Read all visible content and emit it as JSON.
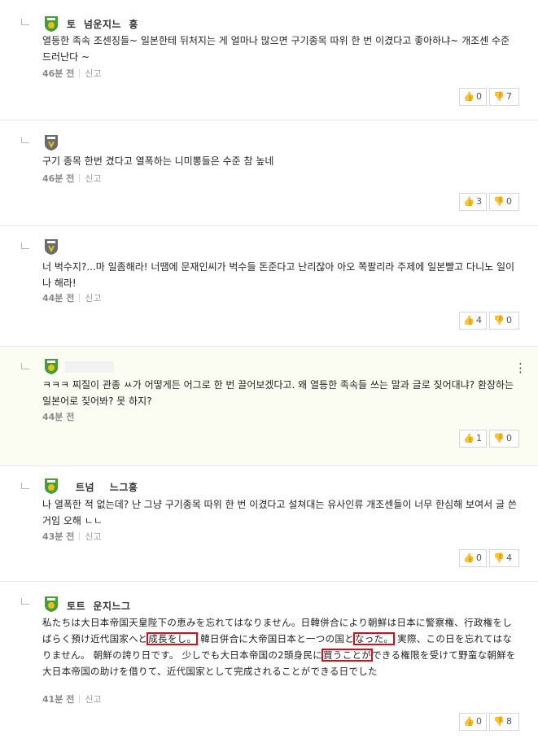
{
  "comments": [
    {
      "nick": "토  넘운지느  흥",
      "body": "열등한 족속 조센징들~ 일본한테 뒤처지는 게 얼마나 많으면 구기종목 따위 한 번 이겼다고 좋아하냐~ 개조센 수준 드러난다 ~",
      "time": "46분 전",
      "report": "신고",
      "likes": "0",
      "dislikes": "7",
      "badge": "green-shield"
    },
    {
      "nick": "",
      "body": "구기 종목 한번 겼다고 열폭하는 니미뽕들은 수준 참 높네",
      "time": "46분 전",
      "report": "신고",
      "likes": "3",
      "dislikes": "0",
      "badge": "gray-shield"
    },
    {
      "nick": "",
      "body": "너 벅수지?...마 일좀해라! 너땜에 문재인씨가 벅수들 돈준다고 난리잖아 아오 쪽팔리라 주제에 일본빨고 다니노 일이나 해라!",
      "time": "44분 전",
      "report": "신고",
      "likes": "4",
      "dislikes": "0",
      "badge": "gray-shield"
    },
    {
      "nick": "",
      "body": "ㅋㅋㅋ 찌질이 관종 ㅆ가 어떻게든 어그로 한 번 끌어보겠다고. 왜 열등한 족속들 쓰는 말과 글로 짖어대냐? 환장하는 일본어로 짖어봐? 못 하지?",
      "time": "44분 전",
      "report": "",
      "likes": "1",
      "dislikes": "0",
      "badge": "green-shield",
      "more": "⋮"
    },
    {
      "nick": "트넘    느그흥",
      "body": "나 열폭한 적 없는데? 난 그냥 구기종목 따위 한 번 이겼다고 설쳐대는 유사인류 개조센들이 너무 한심해 보여서 글 쓴 거임 오해 ㄴㄴ",
      "time": "43분 전",
      "report": "신고",
      "likes": "0",
      "dislikes": "4",
      "badge": "green-shield"
    },
    {
      "nick": "토트  운지느그",
      "body_parts": [
        "私たちは大日本帝国天皇陛下の恵みを忘れてはなりません。日韓併合により朝鮮は日本に警察権、行政権をしばらく預け近代国家へと",
        "成長をし。",
        " 韓日併合に大帝国日本と一つの国と",
        "なった。",
        " 実際、この日を忘れてはなりません。 朝鮮の誇り日です。 少しでも大日本帝国の2頭身民に",
        "買うことが",
        "できる権限を受けて野蛮な朝鮮を大日本帝国の助けを借りて、近代国家として完成されることができる日でした"
      ],
      "time": "41분 전",
      "report": "신고",
      "likes": "0",
      "dislikes": "8",
      "badge": "green-shield"
    }
  ],
  "icons": {
    "like": "thumbs-up-icon",
    "dislike": "thumbs-down-icon",
    "reply": "reply-arrow-icon"
  },
  "colors": {
    "badge_green": "#4a9a3a",
    "badge_yellow": "#e4c21a",
    "badge_gray": "#6b6b6b",
    "highlight_box": "#d0101a"
  }
}
